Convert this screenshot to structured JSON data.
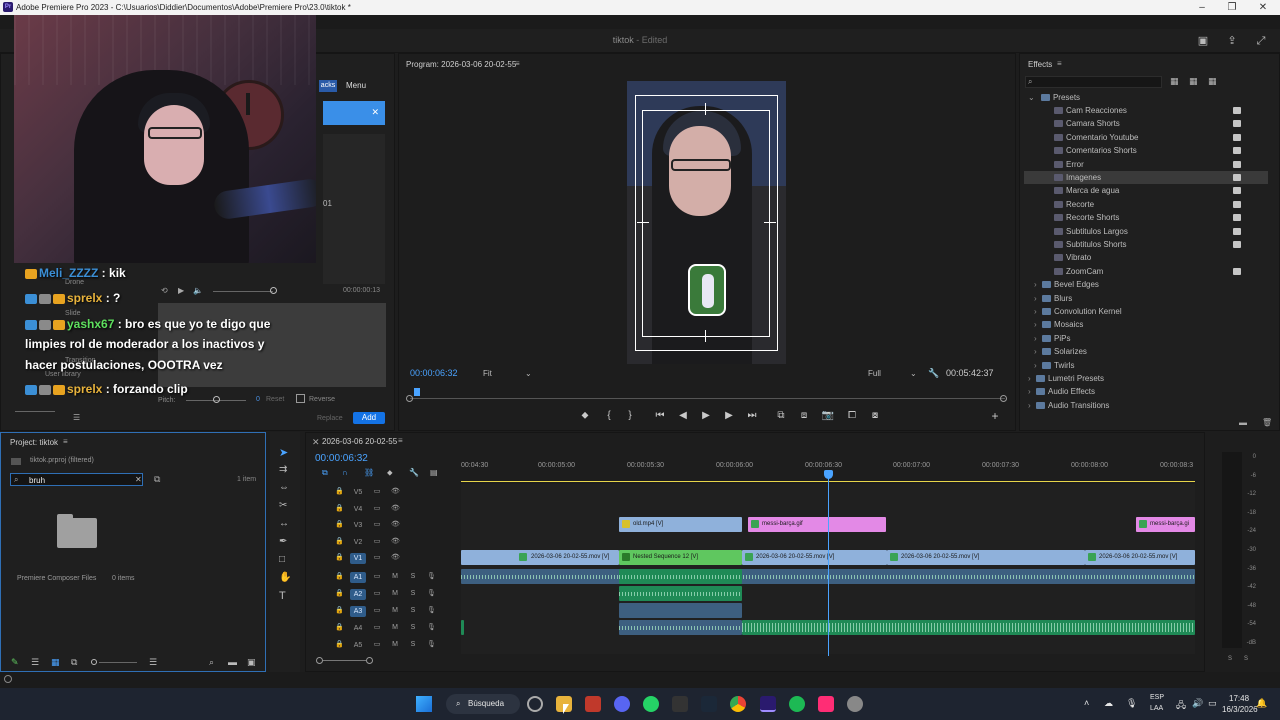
{
  "titlebar": {
    "logo": "Pr",
    "title": "Adobe Premiere Pro 2023 - C:\\Usuarios\\Diddier\\Documentos\\Adobe\\Premiere Pro\\23.0\\tiktok *",
    "min": "–",
    "max": "❐",
    "close": "✕"
  },
  "header": {
    "project": "tiktok",
    "status": "- Edited"
  },
  "source_panel": {
    "tab_partial": "acks",
    "menu": "Menu",
    "clip_num": "01",
    "timecode": "00:00:00:13",
    "replace": "Replace",
    "add": "Add",
    "pitch": "Pitch:",
    "pitch_val": "0",
    "reset": "Reset",
    "reverse": "Reverse",
    "list": [
      "Drone",
      "Slide",
      "Transition",
      "User library"
    ]
  },
  "chat": [
    {
      "user": "Meli_ZZZZ",
      "sep": " : ",
      "msg": "kik",
      "color": "#3b8fd6"
    },
    {
      "user": "sprelx",
      "sep": " : ",
      "msg": "?",
      "color": "#e8b33c"
    },
    {
      "user": "yashx67",
      "sep": " : ",
      "msg": "bro es que yo te digo que",
      "color": "#5ee05e"
    },
    {
      "line": "limpies rol de moderador a los inactivos y"
    },
    {
      "line": "hacer postulaciones, OOOTRA vez"
    },
    {
      "user": "sprelx",
      "sep": " : ",
      "msg": "forzando clip",
      "color": "#e8b33c"
    }
  ],
  "program": {
    "title": "Program: 2026-03-06 20-02-55",
    "timecode": "00:00:06:32",
    "fit": "Fit",
    "quality": "Full",
    "duration": "00:05:42:37"
  },
  "effects": {
    "title": "Effects",
    "root": "Presets",
    "items": [
      {
        "label": "Cam Reacciones",
        "indent": 2,
        "lock": true
      },
      {
        "label": "Camara Shorts",
        "indent": 2,
        "lock": true
      },
      {
        "label": "Comentario Youtube",
        "indent": 2,
        "lock": true
      },
      {
        "label": "Comentarios Shorts",
        "indent": 2,
        "lock": true
      },
      {
        "label": "Error",
        "indent": 2,
        "lock": true
      },
      {
        "label": "Imagenes",
        "indent": 2,
        "lock": true,
        "selected": true
      },
      {
        "label": "Marca de agua",
        "indent": 2,
        "lock": true
      },
      {
        "label": "Recorte",
        "indent": 2,
        "lock": true
      },
      {
        "label": "Recorte Shorts",
        "indent": 2,
        "lock": true
      },
      {
        "label": "Subtitulos Largos",
        "indent": 2,
        "lock": true
      },
      {
        "label": "Subtitulos Shorts",
        "indent": 2,
        "lock": true
      },
      {
        "label": "Vibrato",
        "indent": 2,
        "lock": false
      },
      {
        "label": "ZoomCam",
        "indent": 2,
        "lock": true
      },
      {
        "label": "Bevel Edges",
        "indent": 1,
        "lock": false
      },
      {
        "label": "Blurs",
        "indent": 1,
        "lock": false
      },
      {
        "label": "Convolution Kernel",
        "indent": 1,
        "lock": false
      },
      {
        "label": "Mosaics",
        "indent": 1,
        "lock": false
      },
      {
        "label": "PiPs",
        "indent": 1,
        "lock": false
      },
      {
        "label": "Solarizes",
        "indent": 1,
        "lock": false
      },
      {
        "label": "Twirls",
        "indent": 1,
        "lock": false
      },
      {
        "label": "Lumetri Presets",
        "indent": 0,
        "lock": false
      },
      {
        "label": "Audio Effects",
        "indent": 0,
        "lock": false
      },
      {
        "label": "Audio Transitions",
        "indent": 0,
        "lock": false
      }
    ]
  },
  "project": {
    "title": "Project: tiktok",
    "file": "tiktok.prproj (filtered)",
    "search_value": "bruh",
    "count": "1 item",
    "bin_name": "Premiere Composer Files",
    "bin_items": "0 items"
  },
  "timeline": {
    "tab": "2026-03-06 20-02-55",
    "timecode": "00:00:06:32",
    "ruler": [
      "00:04:30",
      "00:00:05:00",
      "00:00:05:30",
      "00:00:06:00",
      "00:00:06:30",
      "00:00:07:00",
      "00:00:07:30",
      "00:00:08:00",
      "00:00:08:3"
    ],
    "tracks": [
      "V5",
      "V4",
      "V3",
      "V2",
      "V1",
      "A1",
      "A2",
      "A3",
      "A4",
      "A5"
    ],
    "clips": {
      "old": "old.mp4 [V]",
      "messi1": "messi-barça.gif",
      "messi2": "messi-barça.gi",
      "v1a": "2026-03-06 20-02-55.mov [V]",
      "nested": "Nested Sequence 12 [V]",
      "v1b": "2026-03-06 20-02-55.mov [V]",
      "v1c": "2026-03-06 20-02-55.mov [V]",
      "v1d": "2026-03-06 20-02-55.mov [V]"
    },
    "meter_scale": [
      "0",
      "-6",
      "-12",
      "-18",
      "-24",
      "-30",
      "-36",
      "-42",
      "-48",
      "-54",
      "-dB"
    ],
    "meter_solo": [
      "S",
      "S"
    ]
  },
  "taskbar": {
    "search": "Búsqueda",
    "lang": "ESP",
    "lang2": "LAA",
    "time": "17:48",
    "date": "16/3/2026"
  }
}
